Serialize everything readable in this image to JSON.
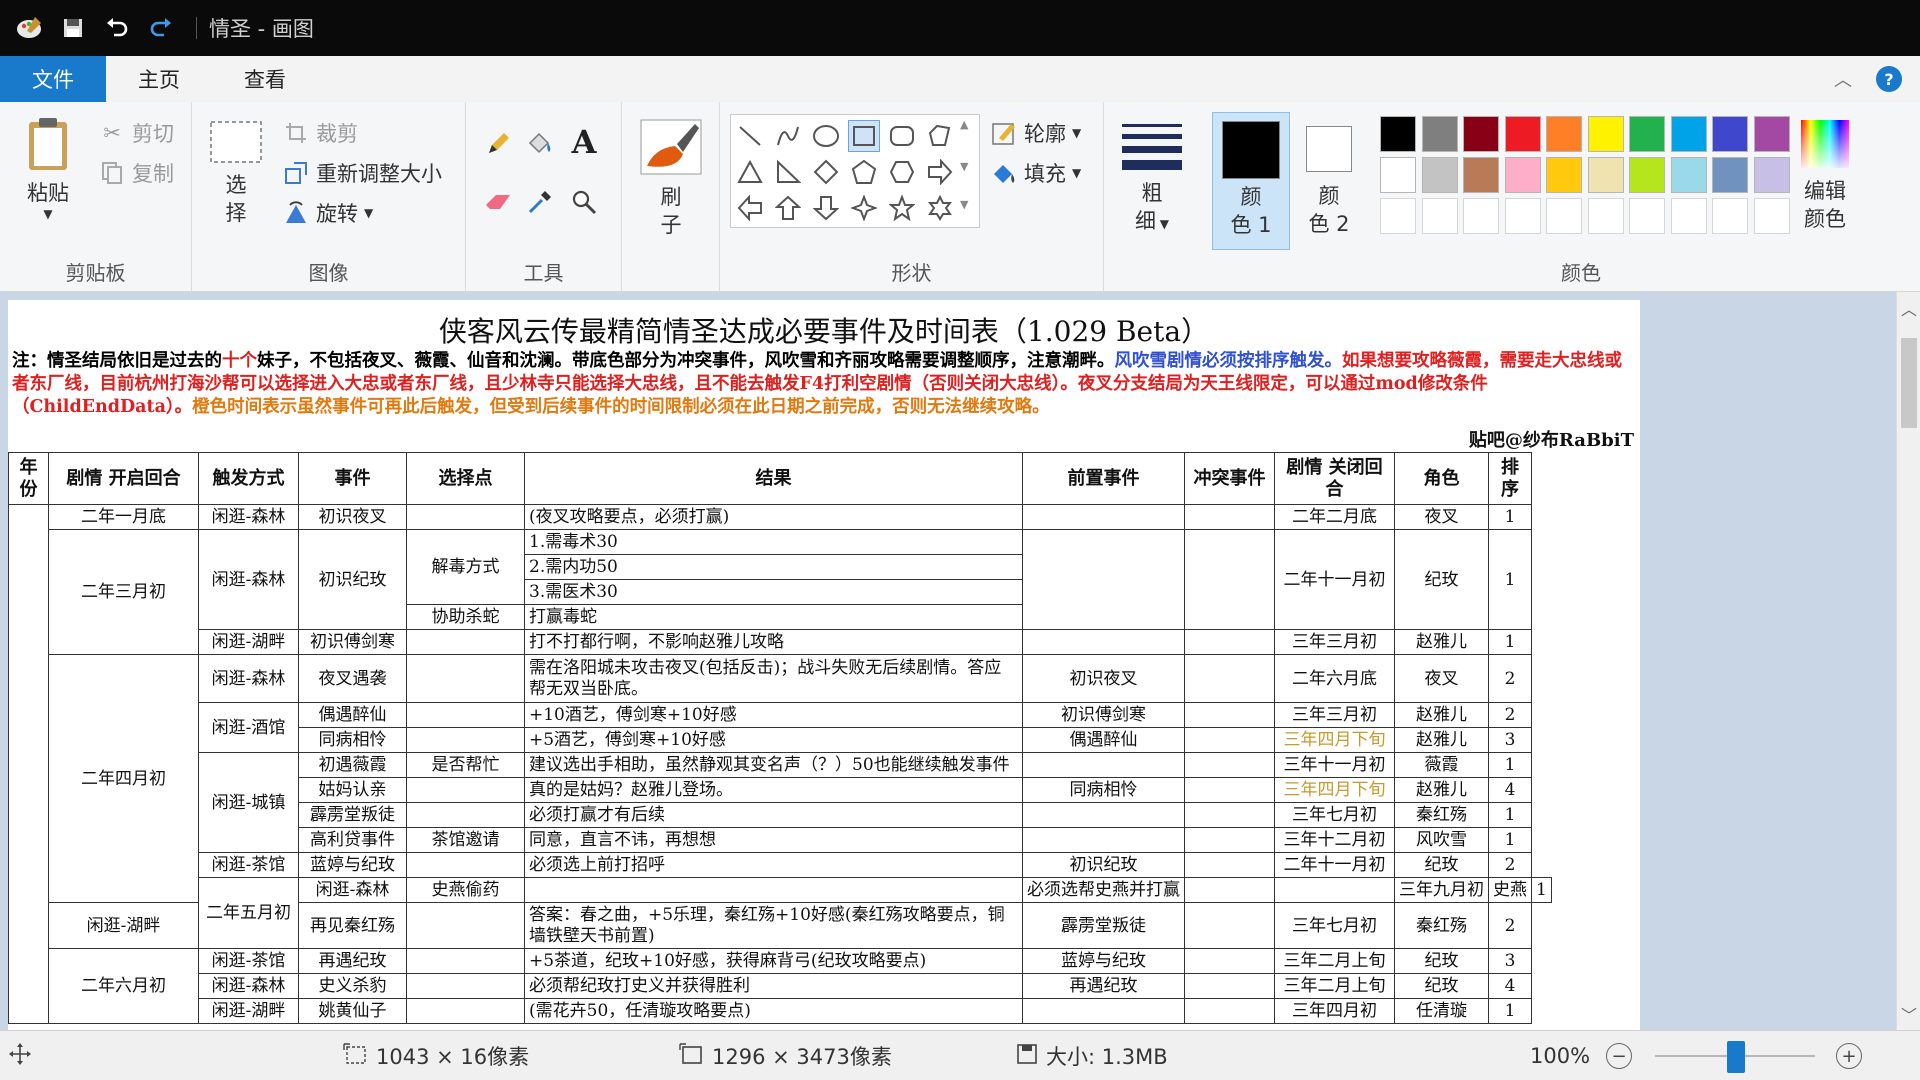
{
  "window": {
    "title": "情圣 - 画图"
  },
  "menu": {
    "file": "文件",
    "home": "主页",
    "view": "查看",
    "help": "?"
  },
  "ribbon": {
    "clipboard": {
      "label": "剪贴板",
      "paste": "粘贴",
      "cut": "剪切",
      "copy": "复制"
    },
    "image": {
      "label": "图像",
      "select_1": "选",
      "select_2": "择",
      "crop": "裁剪",
      "resize": "重新调整大小",
      "rotate": "旋转"
    },
    "tools": {
      "label": "工具"
    },
    "brush": {
      "label_1": "刷",
      "label_2": "子"
    },
    "shapes": {
      "label": "形状",
      "outline": "轮廓",
      "fill": "填充"
    },
    "size": {
      "label_1": "粗",
      "label_2": "细"
    },
    "color1": {
      "label_1": "颜",
      "label_2": "色 1",
      "value": "#000000"
    },
    "color2": {
      "label_1": "颜",
      "label_2": "色 2",
      "value": "#ffffff"
    },
    "colors": {
      "label": "颜色",
      "edit_1": "编辑",
      "edit_2": "颜色",
      "row1": [
        "#000000",
        "#7f7f7f",
        "#880015",
        "#ed1c24",
        "#ff7f27",
        "#fff200",
        "#22b14c",
        "#00a2e8",
        "#3f48cc",
        "#a349a4"
      ],
      "row2": [
        "#ffffff",
        "#c3c3c3",
        "#b97a57",
        "#ffaec9",
        "#ffc90e",
        "#efe4b0",
        "#b5e61d",
        "#99d9ea",
        "#7092be",
        "#c8bfe7"
      ]
    }
  },
  "document": {
    "title": "侠客风云传最精简情圣达成必要事件及时间表（1.029 Beta）",
    "note": [
      {
        "c": "black",
        "t": "注：情圣结局依旧是过去的"
      },
      {
        "c": "red",
        "t": "十个"
      },
      {
        "c": "black",
        "t": "妹子，不包括夜叉、薇霞、仙音和沈澜。带底色部分为冲突事件，风吹雪和齐丽攻略需要调整顺序，注意潮畔。"
      },
      {
        "c": "blue",
        "t": "风吹雪剧情必须按排序触发。"
      },
      {
        "c": "red",
        "t": "如果想要攻略薇霞，需要走大忠线或者东厂线，目前杭州打海沙帮可以选择进入大忠或者东厂线，且少林寺只能选择大忠线，且不能去触发F4打利空剧情（否则关闭大忠线）。夜叉分支结局为天王线限定，可以通过mod修改条件（ChildEndData）。"
      },
      {
        "c": "orange",
        "t": "橙色时间表示虽然事件可再此后触发，但受到后续事件的时间限制必须在此日期之前完成，否则无法继续攻略。"
      }
    ],
    "credit": "贴吧@纱布RaBbiT",
    "headers": {
      "year": "年份",
      "open": "剧情 开启回合",
      "trigger": "触发方式",
      "event": "事件",
      "choice": "选择点",
      "result": "结果",
      "pre": "前置事件",
      "conflict": "冲突事件",
      "close": "剧情 关闭回合",
      "role": "角色",
      "order": "排序"
    },
    "rows": {
      "r1": {
        "open": "二年一月底",
        "trigger": "闲逛-森林",
        "event": "初识夜叉",
        "choice": "",
        "result": "(夜叉攻略要点，必须打赢)",
        "pre": "",
        "close": "二年二月底",
        "role": "夜叉",
        "order": "1"
      },
      "g2": {
        "open": "二年三月初",
        "trigger": "闲逛-森林",
        "event": "初识纪玫",
        "choice_a": "解毒方式",
        "res_a1": "1.需毒术30",
        "res_a2": "2.需内功50",
        "res_a3": "3.需医术30",
        "choice_b": "协助杀蛇",
        "res_b": "打赢毒蛇",
        "close": "二年十一月初",
        "role": "纪玫",
        "order": "1"
      },
      "r_f": {
        "trigger": "闲逛-湖畔",
        "event": "初识傅剑寒",
        "result": "打不打都行啊，不影响赵雅儿攻略",
        "close": "三年三月初",
        "role": "赵雅儿",
        "order": "1"
      },
      "g4_open": "二年四月初",
      "r_y": {
        "trigger": "闲逛-森林",
        "event": "夜叉遇袭",
        "result": "需在洛阳城未攻击夜叉(包括反击)；战斗失败无后续剧情。答应帮无双当卧底。",
        "pre": "初识夜叉",
        "close": "二年六月底",
        "role": "夜叉",
        "order": "2"
      },
      "bar_trigger": "闲逛-酒馆",
      "r_z": {
        "event": "偶遇醉仙",
        "result": "+10酒艺，傅剑寒+10好感",
        "pre": "初识傅剑寒",
        "close": "三年三月初",
        "role": "赵雅儿",
        "order": "2"
      },
      "r_t": {
        "event": "同病相怜",
        "result": "+5酒艺，傅剑寒+10好感",
        "pre": "偶遇醉仙",
        "close": "三年四月下旬",
        "role": "赵雅儿",
        "order": "3"
      },
      "town_trigger": "闲逛-城镇",
      "r_w": {
        "event": "初遇薇霞",
        "choice": "是否帮忙",
        "result": "建议选出手相助，虽然静观其变名声（？）50也能继续触发事件",
        "close": "三年十一月初",
        "role": "薇霞",
        "order": "1"
      },
      "r_g": {
        "event": "姑妈认亲",
        "result": "真的是姑妈？赵雅儿登场。",
        "pre": "同病相怜",
        "close": "三年四月下旬",
        "role": "赵雅儿",
        "order": "4"
      },
      "r_p": {
        "event": "霹雳堂叛徒",
        "result": "必须打赢才有后续",
        "close": "三年七月初",
        "role": "秦红殇",
        "order": "1"
      },
      "r_l": {
        "event": "高利贷事件",
        "choice": "茶馆邀请",
        "result": "同意，直言不讳，再想想",
        "close": "三年十二月初",
        "role": "风吹雪",
        "order": "1"
      },
      "r_ln": {
        "trigger": "闲逛-茶馆",
        "event": "蓝婷与纪玫",
        "result": "必须选上前打招呼",
        "pre": "初识纪玫",
        "close": "二年十一月初",
        "role": "纪玫",
        "order": "2"
      },
      "g5_open": "二年五月初",
      "r_s": {
        "trigger": "闲逛-森林",
        "event": "史燕偷药",
        "result": "必须选帮史燕并打赢",
        "close": "三年九月初",
        "role": "史燕",
        "order": "1"
      },
      "r_q": {
        "trigger": "闲逛-湖畔",
        "event": "再见秦红殇",
        "result": "答案：春之曲，+5乐理，秦红殇+10好感(秦红殇攻略要点，铜墙铁壁天书前置)",
        "pre": "霹雳堂叛徒",
        "close": "三年七月初",
        "role": "秦红殇",
        "order": "2"
      },
      "g6_open": "二年六月初",
      "r_j": {
        "trigger": "闲逛-茶馆",
        "event": "再遇纪玫",
        "result": "+5茶道，纪玫+10好感，获得麻背弓(纪玫攻略要点)",
        "pre": "蓝婷与纪玫",
        "close": "三年二月上旬",
        "role": "纪玫",
        "order": "3"
      },
      "r_sy": {
        "trigger": "闲逛-森林",
        "event": "史义杀豹",
        "result": "必须帮纪玫打史义并获得胜利",
        "pre": "再遇纪玫",
        "close": "三年二月上旬",
        "role": "纪玫",
        "order": "4"
      },
      "r_h": {
        "trigger": "闲逛-湖畔",
        "event": "姚黄仙子",
        "result": "(需花卉50，任清璇攻略要点)",
        "close": "三年四月初",
        "role": "任清璇",
        "order": "1"
      }
    }
  },
  "status": {
    "selection": "1043 × 16像素",
    "image_size": "1296 × 3473像素",
    "file_size": "大小: 1.3MB",
    "zoom": "100%"
  }
}
